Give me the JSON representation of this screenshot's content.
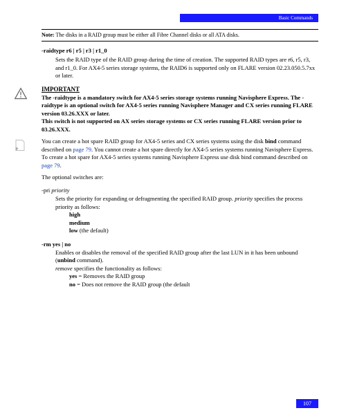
{
  "header": {
    "section": "Basic Commands"
  },
  "note": {
    "label": "Note:",
    "text": "The disks in a RAID group must be either all Fibre Channel disks or all ATA disks."
  },
  "raidtype": {
    "heading": "-raidtype r6 | r5 | r3 | r1_0",
    "body": "Sets the RAID type of the RAID group during the time of creation. The supported RAID types are r6, r5, r3, and r1_0. For AX4-5 series storage systems, the RAID6 is supported only on FLARE version 02.23.050.5.7xx or later."
  },
  "important": {
    "label": "IMPORTANT",
    "text": "The -raidtype is a mandatory switch for AX4-5 series storage systems running Navisphere Express. The -raidtype is an optional switch for AX4-5 series running Navisphere Manager and CX series running FLARE version 03.26.XXX or later.\nThis switch is not supported on AX series storage systems or CX series running FLARE version prior to 03.26.XXX."
  },
  "callout": {
    "pre": "You can create a hot spare RAID group for AX4-5 series and CX series systems using the disk ",
    "bold1": "bind",
    "mid1": " command described on ",
    "link1": "page 79",
    "mid2": ". You cannot create a hot spare directly for AX4-5 series systems running Navisphere Express. To create a hot spare for AX4-5 series systems running Navisphere Express use disk bind command described on ",
    "link2": "page 79",
    "post": "."
  },
  "optional_intro": "The optional switches are:",
  "pri": {
    "name": "-pri",
    "arg": "priority",
    "desc_pre": "Sets the priority for expanding or defragmenting the specified RAID group. ",
    "desc_arg": "priority",
    "desc_post": " specifies the process priority as follows:",
    "v1": "high",
    "v2": "medium",
    "v3_pre": "low",
    "v3_post": " (the default)"
  },
  "rm": {
    "name": "-rm yes | no",
    "desc_pre": "Enables or disables the removal of the specified RAID group after the last LUN in it has been unbound (",
    "desc_bold": "unbind",
    "desc_mid": " command).\n",
    "desc_arg": "remove",
    "desc_post": " specifies the functionality as follows:",
    "v1_pre": "yes",
    "v1_post": " = Removes the RAID group",
    "v2_pre": "no",
    "v2_post": " = Does not remove the RAID group (the default"
  },
  "page_number": "107"
}
